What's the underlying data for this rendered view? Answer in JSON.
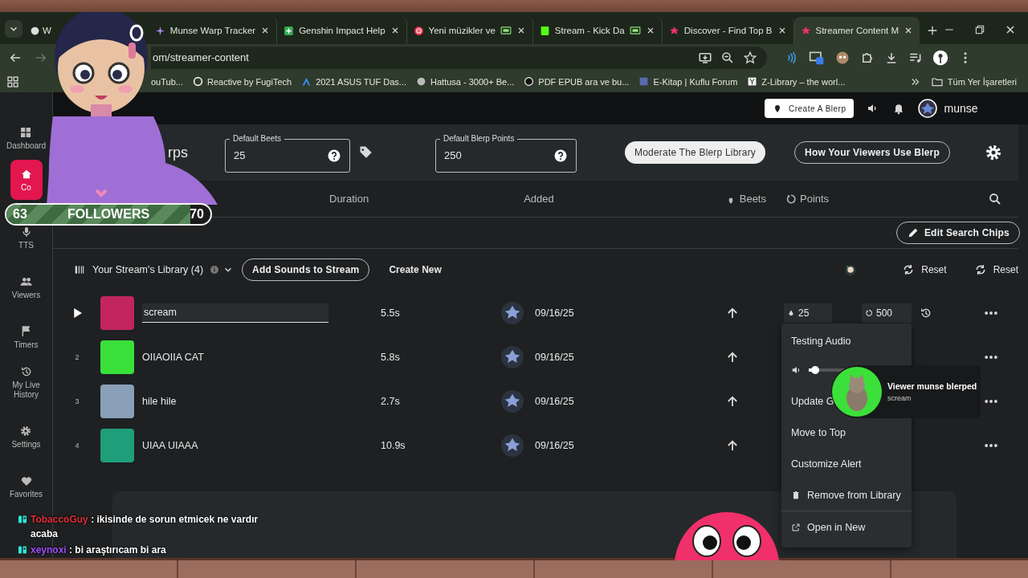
{
  "browser": {
    "tabs": [
      {
        "title": "W",
        "selected": false
      },
      {
        "title": "Munse Warp Tracker",
        "selected": false
      },
      {
        "title": "Genshin Impact Help",
        "selected": false
      },
      {
        "title": "Yeni müzikler ve",
        "selected": false
      },
      {
        "title": "Stream - Kick Da",
        "selected": false
      },
      {
        "title": "Discover - Find Top B",
        "selected": false
      },
      {
        "title": "Streamer Content M",
        "selected": true
      }
    ],
    "address": "om/streamer-content",
    "bookmarks": [
      "ouTub...",
      "Reactive by FugiTech",
      "2021 ASUS TUF Das...",
      "Hattusa - 3000+ Be...",
      "PDF EPUB ara ve bu...",
      "E-Kitap | Kuflu Forum",
      "Z-Library – the worl..."
    ],
    "all_bookmarks": "Tüm Yer İşaretleri"
  },
  "app": {
    "create_button": "Create A Blerp",
    "username": "munse",
    "sidebar": [
      {
        "label": "Dashboard",
        "selected": false
      },
      {
        "label": "Co",
        "selected": true
      },
      {
        "label": "TTS",
        "selected": false
      },
      {
        "label": "Viewers",
        "selected": false
      },
      {
        "label": "Timers",
        "selected": false
      },
      {
        "label": "My Live History",
        "selected": false
      },
      {
        "label": "Settings",
        "selected": false
      },
      {
        "label": "Favorites",
        "selected": false
      }
    ],
    "title": "rps",
    "fields": [
      {
        "label": "Default Beets",
        "value": "25"
      },
      {
        "label": "Default Blerp Points",
        "value": "250"
      }
    ],
    "buttons": [
      {
        "label": "Moderate The Blerp Library",
        "kind": "filled"
      },
      {
        "label": "How Your Viewers Use Blerp",
        "kind": "outlined"
      }
    ],
    "columns": [
      "Duration",
      "Added",
      "Beets",
      "Points"
    ],
    "edit_chips": "Edit Search Chips",
    "library": {
      "title": "Your Stream's Library (4)",
      "add_button": "Add Sounds to Stream",
      "create_new": "Create New",
      "resets": [
        "Reset",
        "Reset"
      ]
    },
    "rows": [
      {
        "hovered": true,
        "name": "scream",
        "duration": "5.5s",
        "added": "09/16/25",
        "beets": "25",
        "points": "500",
        "color": "#c2255c"
      },
      {
        "hovered": false,
        "index": "2",
        "name": "OIIAOIIA CAT",
        "duration": "5.8s",
        "added": "09/16/25",
        "color": "#39e03a"
      },
      {
        "hovered": false,
        "index": "3",
        "name": "hile hile",
        "duration": "2.7s",
        "added": "09/16/25",
        "color": "#8aa0b8"
      },
      {
        "hovered": false,
        "index": "4",
        "name": "UIAA UIAAA",
        "duration": "10.9s",
        "added": "09/16/25",
        "color": "#1f9e7a"
      }
    ]
  },
  "menu": [
    {
      "kind": "title",
      "label": "Testing Audio"
    },
    {
      "kind": "slider",
      "level": 0.07
    },
    {
      "kind": "item",
      "label": "Update G"
    },
    {
      "kind": "item",
      "label": "Move to Top"
    },
    {
      "kind": "item",
      "label": "Customize Alert"
    },
    {
      "kind": "delete",
      "label": "Remove from Library"
    },
    {
      "kind": "link",
      "label": "Open in New"
    }
  ],
  "alert": {
    "title": "Viewer munse blerped",
    "sound": "scream"
  },
  "followers": {
    "current": "63",
    "label": "FOLLOWERS",
    "goal": "70",
    "level": 0.9
  },
  "chat": [
    {
      "user": "TobaccoGuy",
      "color": "#e0303a",
      "text": ": ikisinde de sorun etmicek ne vardır acaba"
    },
    {
      "user": "xeynoxi",
      "color": "#a050ff",
      "text": ": bi araştırıcam bi ara"
    }
  ]
}
